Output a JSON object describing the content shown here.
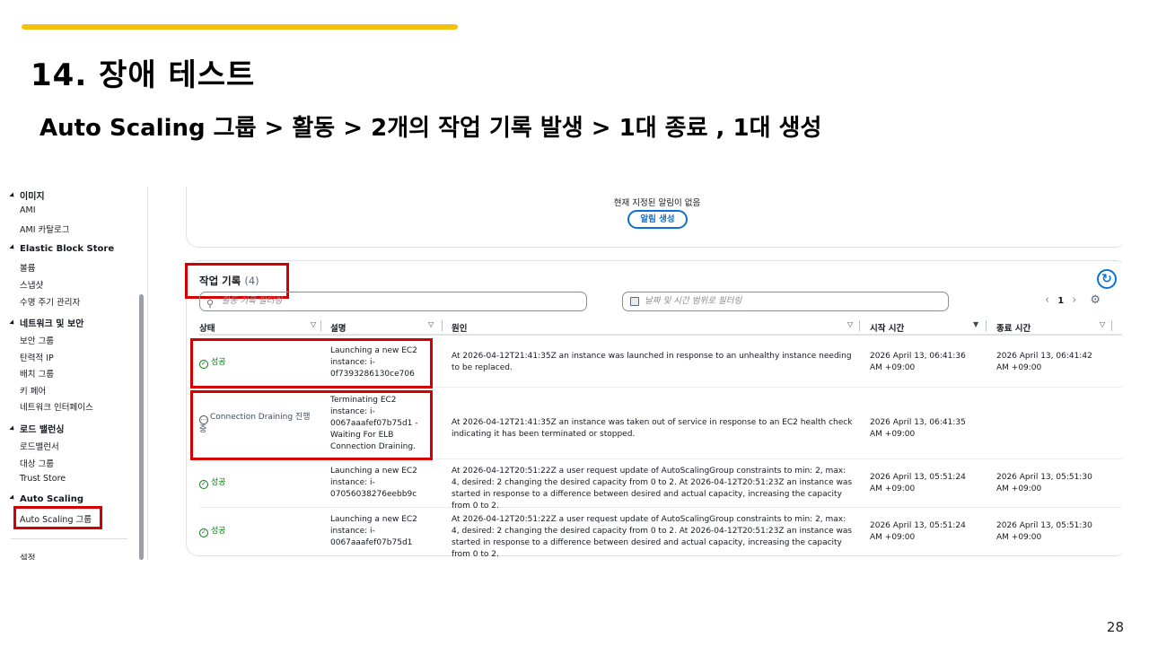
{
  "slide": {
    "title": "14. 장애 테스트",
    "subtitle": "Auto Scaling 그룹 > 활동 > 2개의 작업 기록 발생 > 1대 종료 , 1대 생성",
    "page_number": "28"
  },
  "sidebar": {
    "partial_top": "이미지",
    "sections": [
      {
        "label": "Elastic Block Store"
      },
      {
        "label": "네트워크 및 보안"
      },
      {
        "label": "로드 밸런싱"
      },
      {
        "label": "Auto Scaling"
      }
    ],
    "items": {
      "ami": "AMI",
      "ami_catalog": "AMI 카탈로그",
      "volumes": "볼륨",
      "snapshots": "스냅샷",
      "lifecycle": "수명 주기 관리자",
      "security_groups": "보안 그룹",
      "elastic_ip": "탄력적 IP",
      "placement_groups": "배치 그룹",
      "key_pairs": "키 페어",
      "network_interfaces": "네트워크 인터페이스",
      "load_balancers": "로드밸런서",
      "target_groups": "대상 그룹",
      "trust_store": "Trust Store",
      "asg": "Auto Scaling 그룹",
      "partial_bottom": "설정"
    }
  },
  "alarms": {
    "empty_text": "현재 지정된 알림이 없음",
    "create_button": "알림 생성"
  },
  "activity": {
    "title": "작업 기록",
    "count": "(4)",
    "search_placeholder": "활동 기록 필터링",
    "date_placeholder": "날짜 및 시간 범위로 필터링",
    "page": "1",
    "columns": {
      "status": "상태",
      "description": "설명",
      "cause": "원인",
      "start_time": "시작 시간",
      "end_time": "종료 시간"
    },
    "rows": [
      {
        "status": "성공",
        "description": "Launching a new EC2 instance: i-0f7393286130ce706",
        "cause": "At 2026-04-12T21:41:35Z an instance was launched in response to an unhealthy instance needing to be replaced.",
        "start": "2026 April 13, 06:41:36 AM +09:00",
        "end": "2026 April 13, 06:41:42 AM +09:00"
      },
      {
        "status": "Connection Draining 진행 중",
        "description": "Terminating EC2 instance: i-0067aaafef07b75d1 - Waiting For ELB Connection Draining.",
        "cause": "At 2026-04-12T21:41:35Z an instance was taken out of service in response to an EC2 health check indicating it has been terminated or stopped.",
        "start": "2026 April 13, 06:41:35 AM +09:00",
        "end": ""
      },
      {
        "status": "성공",
        "description": "Launching a new EC2 instance: i-07056038276eebb9c",
        "cause": "At 2026-04-12T20:51:22Z a user request update of AutoScalingGroup constraints to min: 2, max: 4, desired: 2 changing the desired capacity from 0 to 2. At 2026-04-12T20:51:23Z an instance was started in response to a difference between desired and actual capacity, increasing the capacity from 0 to 2.",
        "start": "2026 April 13, 05:51:24 AM +09:00",
        "end": "2026 April 13, 05:51:30 AM +09:00"
      },
      {
        "status": "성공",
        "description": "Launching a new EC2 instance: i-0067aaafef07b75d1",
        "cause": "At 2026-04-12T20:51:22Z a user request update of AutoScalingGroup constraints to min: 2, max: 4, desired: 2 changing the desired capacity from 0 to 2. At 2026-04-12T20:51:23Z an instance was started in response to a difference between desired and actual capacity, increasing the capacity from 0 to 2.",
        "start": "2026 April 13, 05:51:24 AM +09:00",
        "end": "2026 April 13, 05:51:30 AM +09:00"
      }
    ]
  },
  "colors": {
    "highlight": "#d40000",
    "accent": "#0972d3",
    "success": "#037f0c",
    "title_bar": "#f2c20e"
  }
}
